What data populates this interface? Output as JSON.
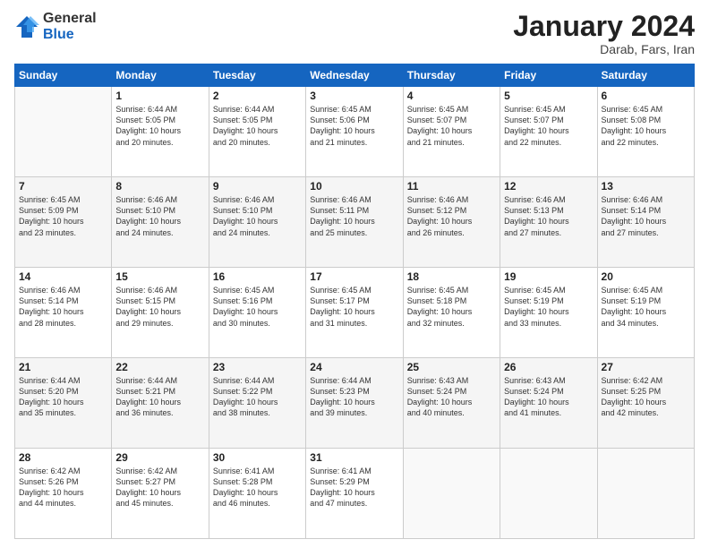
{
  "logo": {
    "general": "General",
    "blue": "Blue"
  },
  "title": {
    "month": "January 2024",
    "location": "Darab, Fars, Iran"
  },
  "weekdays": [
    "Sunday",
    "Monday",
    "Tuesday",
    "Wednesday",
    "Thursday",
    "Friday",
    "Saturday"
  ],
  "weeks": [
    [
      {
        "day": "",
        "info": ""
      },
      {
        "day": "1",
        "info": "Sunrise: 6:44 AM\nSunset: 5:05 PM\nDaylight: 10 hours\nand 20 minutes."
      },
      {
        "day": "2",
        "info": "Sunrise: 6:44 AM\nSunset: 5:05 PM\nDaylight: 10 hours\nand 20 minutes."
      },
      {
        "day": "3",
        "info": "Sunrise: 6:45 AM\nSunset: 5:06 PM\nDaylight: 10 hours\nand 21 minutes."
      },
      {
        "day": "4",
        "info": "Sunrise: 6:45 AM\nSunset: 5:07 PM\nDaylight: 10 hours\nand 21 minutes."
      },
      {
        "day": "5",
        "info": "Sunrise: 6:45 AM\nSunset: 5:07 PM\nDaylight: 10 hours\nand 22 minutes."
      },
      {
        "day": "6",
        "info": "Sunrise: 6:45 AM\nSunset: 5:08 PM\nDaylight: 10 hours\nand 22 minutes."
      }
    ],
    [
      {
        "day": "7",
        "info": ""
      },
      {
        "day": "8",
        "info": "Sunrise: 6:46 AM\nSunset: 5:10 PM\nDaylight: 10 hours\nand 24 minutes."
      },
      {
        "day": "9",
        "info": "Sunrise: 6:46 AM\nSunset: 5:10 PM\nDaylight: 10 hours\nand 24 minutes."
      },
      {
        "day": "10",
        "info": "Sunrise: 6:46 AM\nSunset: 5:11 PM\nDaylight: 10 hours\nand 25 minutes."
      },
      {
        "day": "11",
        "info": "Sunrise: 6:46 AM\nSunset: 5:12 PM\nDaylight: 10 hours\nand 26 minutes."
      },
      {
        "day": "12",
        "info": "Sunrise: 6:46 AM\nSunset: 5:13 PM\nDaylight: 10 hours\nand 27 minutes."
      },
      {
        "day": "13",
        "info": "Sunrise: 6:46 AM\nSunset: 5:14 PM\nDaylight: 10 hours\nand 27 minutes."
      }
    ],
    [
      {
        "day": "14",
        "info": ""
      },
      {
        "day": "15",
        "info": "Sunrise: 6:46 AM\nSunset: 5:15 PM\nDaylight: 10 hours\nand 29 minutes."
      },
      {
        "day": "16",
        "info": "Sunrise: 6:45 AM\nSunset: 5:16 PM\nDaylight: 10 hours\nand 30 minutes."
      },
      {
        "day": "17",
        "info": "Sunrise: 6:45 AM\nSunset: 5:17 PM\nDaylight: 10 hours\nand 31 minutes."
      },
      {
        "day": "18",
        "info": "Sunrise: 6:45 AM\nSunset: 5:18 PM\nDaylight: 10 hours\nand 32 minutes."
      },
      {
        "day": "19",
        "info": "Sunrise: 6:45 AM\nSunset: 5:19 PM\nDaylight: 10 hours\nand 33 minutes."
      },
      {
        "day": "20",
        "info": "Sunrise: 6:45 AM\nSunset: 5:19 PM\nDaylight: 10 hours\nand 34 minutes."
      }
    ],
    [
      {
        "day": "21",
        "info": ""
      },
      {
        "day": "22",
        "info": "Sunrise: 6:44 AM\nSunset: 5:21 PM\nDaylight: 10 hours\nand 36 minutes."
      },
      {
        "day": "23",
        "info": "Sunrise: 6:44 AM\nSunset: 5:22 PM\nDaylight: 10 hours\nand 38 minutes."
      },
      {
        "day": "24",
        "info": "Sunrise: 6:44 AM\nSunset: 5:23 PM\nDaylight: 10 hours\nand 39 minutes."
      },
      {
        "day": "25",
        "info": "Sunrise: 6:43 AM\nSunset: 5:24 PM\nDaylight: 10 hours\nand 40 minutes."
      },
      {
        "day": "26",
        "info": "Sunrise: 6:43 AM\nSunset: 5:24 PM\nDaylight: 10 hours\nand 41 minutes."
      },
      {
        "day": "27",
        "info": "Sunrise: 6:42 AM\nSunset: 5:25 PM\nDaylight: 10 hours\nand 42 minutes."
      }
    ],
    [
      {
        "day": "28",
        "info": "Sunrise: 6:42 AM\nSunset: 5:26 PM\nDaylight: 10 hours\nand 44 minutes."
      },
      {
        "day": "29",
        "info": "Sunrise: 6:42 AM\nSunset: 5:27 PM\nDaylight: 10 hours\nand 45 minutes."
      },
      {
        "day": "30",
        "info": "Sunrise: 6:41 AM\nSunset: 5:28 PM\nDaylight: 10 hours\nand 46 minutes."
      },
      {
        "day": "31",
        "info": "Sunrise: 6:41 AM\nSunset: 5:29 PM\nDaylight: 10 hours\nand 47 minutes."
      },
      {
        "day": "",
        "info": ""
      },
      {
        "day": "",
        "info": ""
      },
      {
        "day": "",
        "info": ""
      }
    ]
  ],
  "week1_row0_day0": "",
  "week1_row0_sun_info": "Sunrise: 6:45 AM\nSunset: 5:09 PM\nDaylight: 10 hours\nand 23 minutes.",
  "week3_row0_sun_info": "Sunrise: 6:46 AM\nSunset: 5:14 PM\nDaylight: 10 hours\nand 28 minutes.",
  "week4_row0_sun_info": "Sunrise: 6:44 AM\nSunset: 5:20 PM\nDaylight: 10 hours\nand 35 minutes."
}
